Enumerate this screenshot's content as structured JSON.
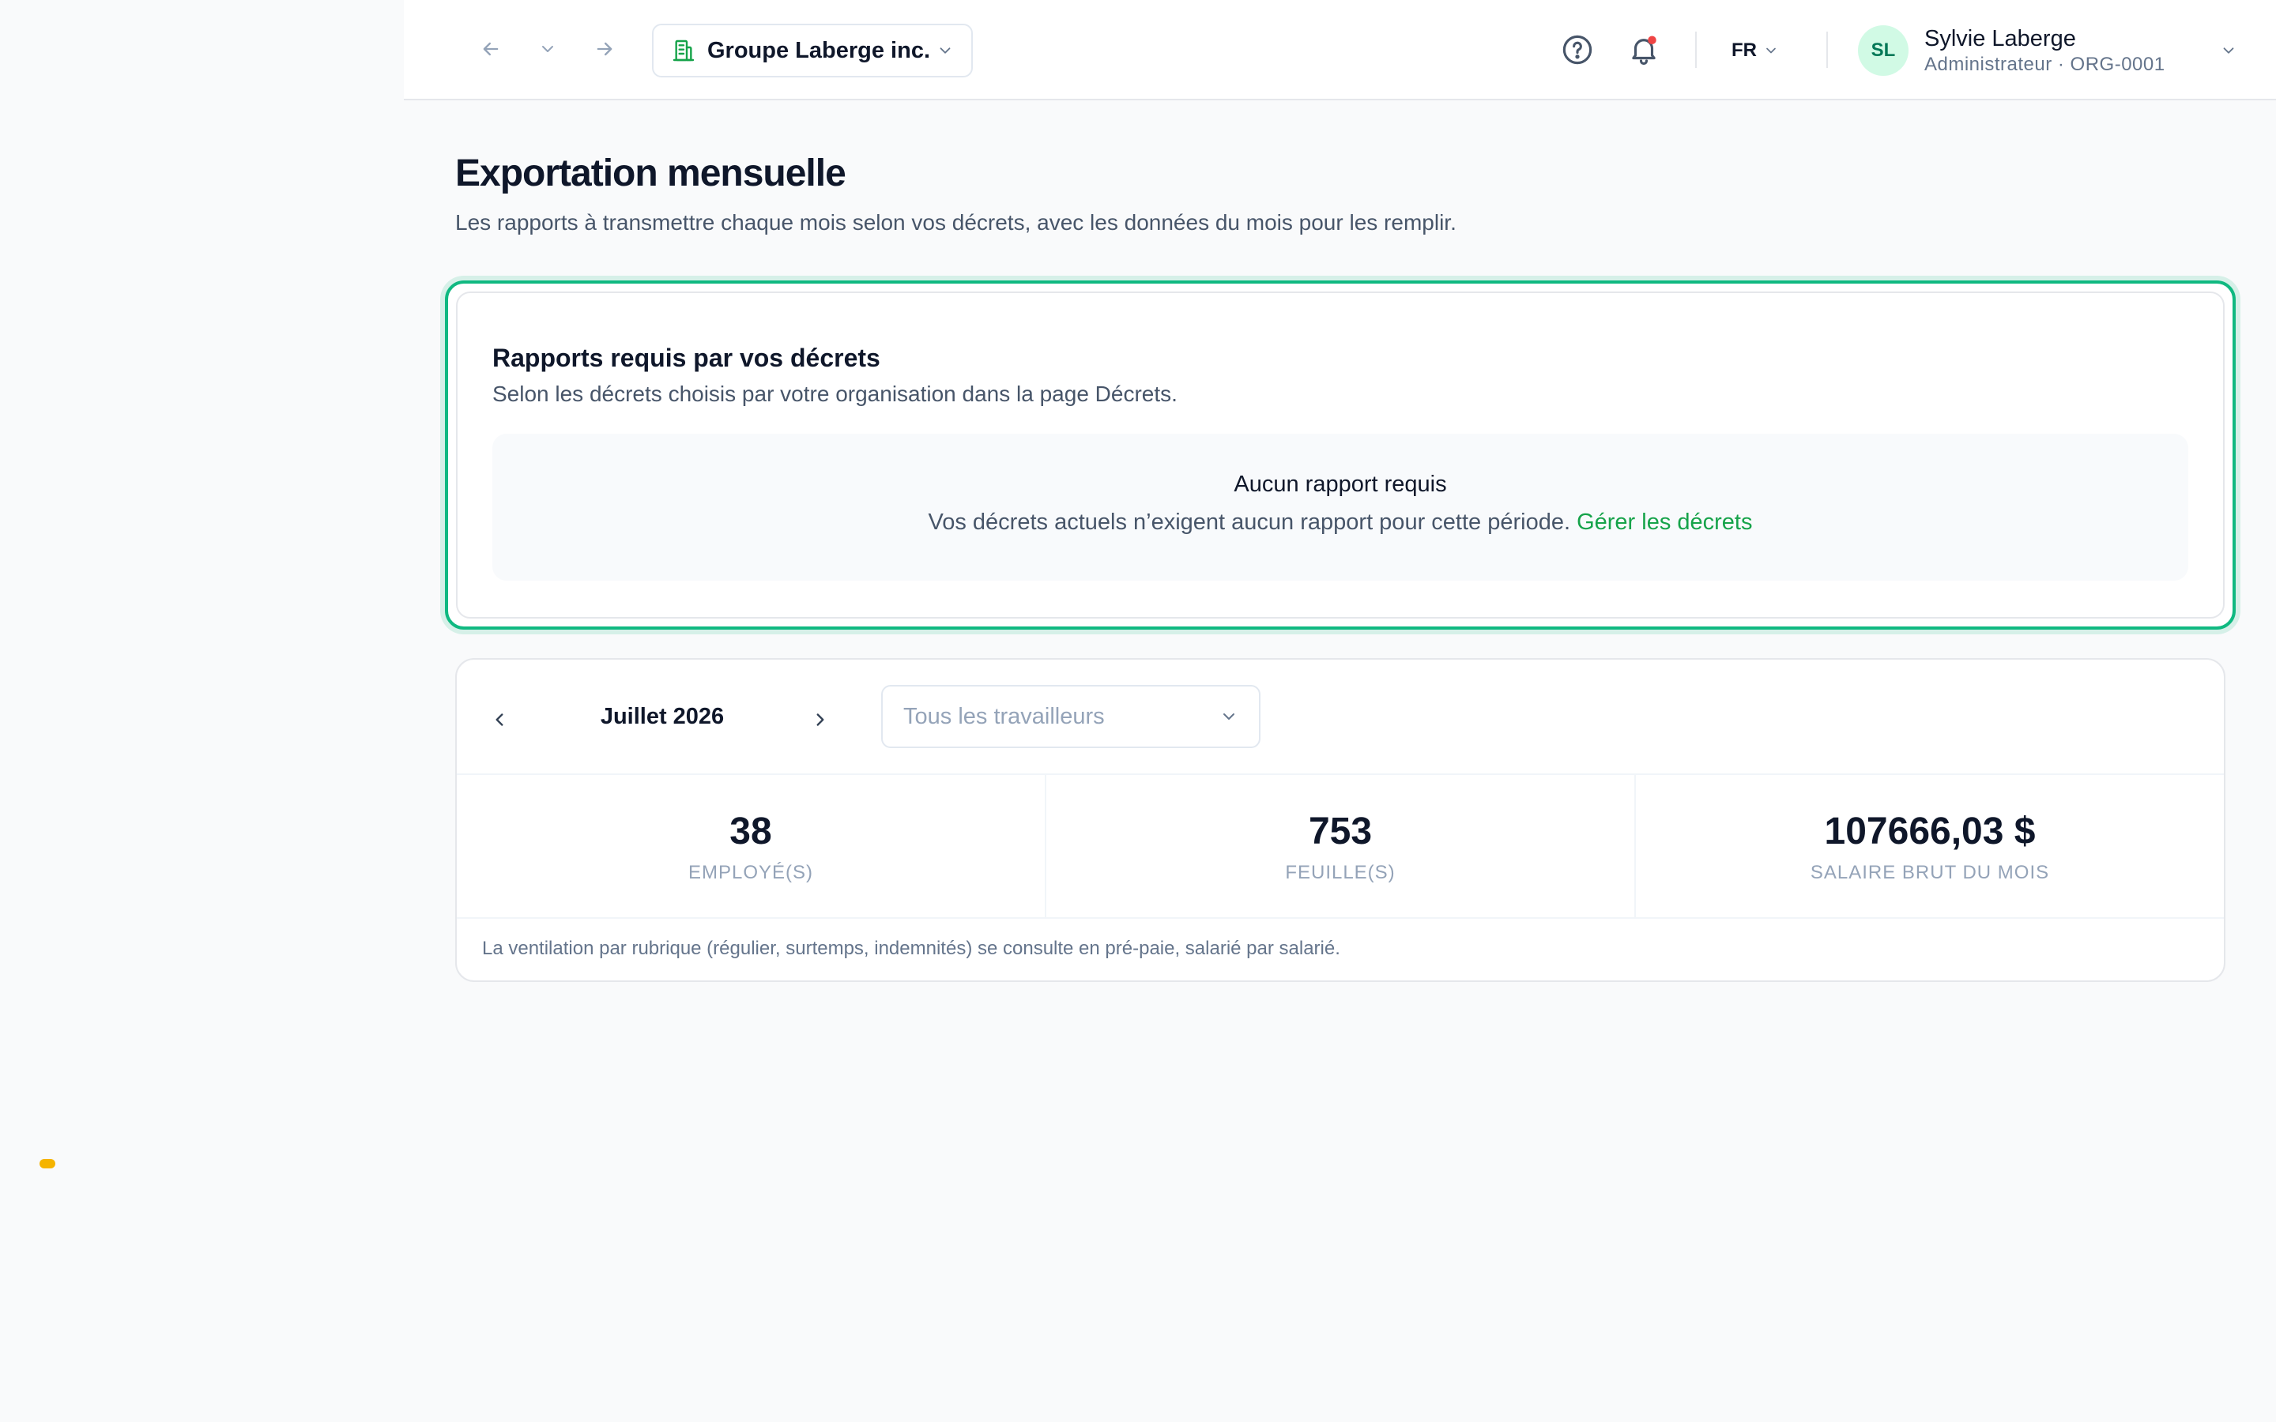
{
  "header": {
    "org_name": "Groupe Laberge inc.",
    "language": "FR",
    "user": {
      "initials": "SL",
      "name": "Sylvie Laberge",
      "role": "Administrateur · ORG-0001"
    },
    "notification_dot_color": "#ef4444"
  },
  "page": {
    "title": "Exportation mensuelle",
    "subtitle": "Les rapports à transmettre chaque mois selon vos décrets, avec les données du mois pour les remplir."
  },
  "required_reports": {
    "title": "Rapports requis par vos décrets",
    "subtitle": "Selon les décrets choisis par votre organisation dans la page Décrets.",
    "empty_title": "Aucun rapport requis",
    "empty_text": "Vos décrets actuels n’exigent aucun rapport pour cette période.",
    "manage_link": "Gérer les décrets",
    "accent_color": "#10b981"
  },
  "period": {
    "month_label": "Juillet 2026",
    "worker_filter_placeholder": "Tous les travailleurs"
  },
  "stats": [
    {
      "value": "38",
      "label": "EMPLOYÉ(S)"
    },
    {
      "value": "753",
      "label": "FEUILLE(S)"
    },
    {
      "value": "107666,03 $",
      "label": "SALAIRE BRUT DU MOIS"
    }
  ],
  "footnote": "La ventilation par rubrique (régulier, surtemps, indemnités) se consulte en pré-paie, salarié par salarié."
}
